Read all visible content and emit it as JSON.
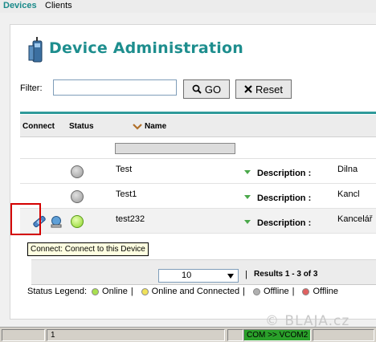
{
  "nav": {
    "devices": "Devices",
    "clients": "Clients"
  },
  "page": {
    "title": "Device Administration"
  },
  "filter": {
    "label": "Filter:",
    "value": "",
    "go_label": "GO",
    "reset_label": "Reset"
  },
  "table": {
    "headers": {
      "connect": "Connect",
      "status": "Status",
      "name": "Name"
    },
    "rows": [
      {
        "name": "Test",
        "status": "offline",
        "description_label": "Description :",
        "description": "Dilna"
      },
      {
        "name": "Test1",
        "status": "offline",
        "description_label": "Description :",
        "description": "Kancl"
      },
      {
        "name": "test232",
        "status": "online",
        "description_label": "Description :",
        "description": "Kancelář"
      }
    ]
  },
  "pager": {
    "page_size": "10",
    "separator": "|",
    "results": "Results 1 - 3 of 3"
  },
  "tooltip": "Connect: Connect to this Device",
  "legend": {
    "title": "Status Legend:",
    "online": "Online",
    "online_connected": "Online and Connected",
    "offline": "Offline",
    "offline2": "Offline",
    "sep": "|"
  },
  "watermark": "© BLAJA.cz",
  "statusbar": {
    "cell2": "1",
    "com": "COM >> VCOM2"
  },
  "colors": {
    "accent": "#1e8e8e",
    "online": "#8ed42a",
    "offline": "#9a9a9a",
    "highlight": "#d40000"
  }
}
